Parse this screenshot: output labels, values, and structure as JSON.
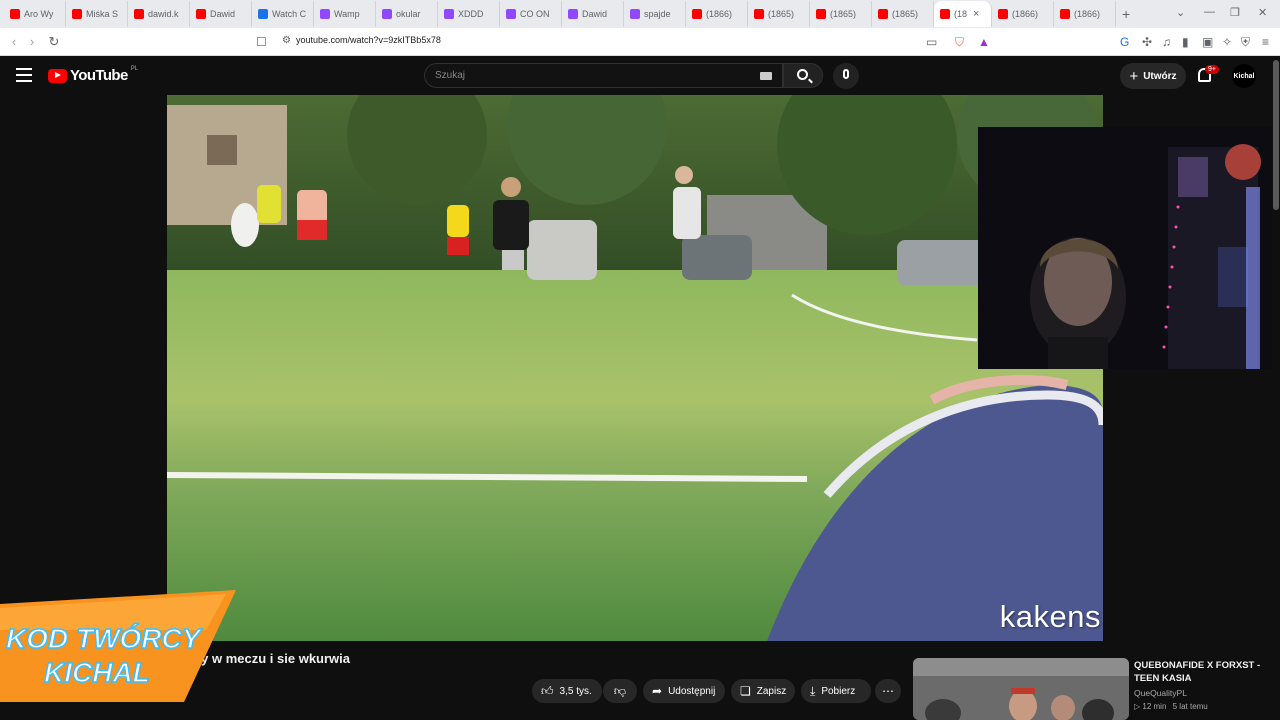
{
  "browser": {
    "tabs": [
      {
        "label": "Aro Wy",
        "color": "#ff0000"
      },
      {
        "label": "Miśka S",
        "color": "#ff0000"
      },
      {
        "label": "dawid.k",
        "color": "#ff0000"
      },
      {
        "label": "Dawid",
        "color": "#ff0000"
      },
      {
        "label": "Watch C",
        "color": "#1a73e8"
      },
      {
        "label": "Wamp",
        "color": "#9146ff"
      },
      {
        "label": "okular",
        "color": "#9146ff"
      },
      {
        "label": "XDDD",
        "color": "#9146ff"
      },
      {
        "label": "CO ON",
        "color": "#9146ff"
      },
      {
        "label": "Dawid",
        "color": "#9146ff"
      },
      {
        "label": "spajde",
        "color": "#9146ff"
      },
      {
        "label": "(1866)",
        "color": "#ff0000"
      },
      {
        "label": "(1865)",
        "color": "#ff0000"
      },
      {
        "label": "(1865)",
        "color": "#ff0000"
      },
      {
        "label": "(1865)",
        "color": "#ff0000"
      },
      {
        "label": "(18",
        "color": "#ff0000",
        "active": true
      },
      {
        "label": "(1866)",
        "color": "#ff0000"
      },
      {
        "label": "(1866)",
        "color": "#ff0000"
      }
    ],
    "new_tab": "+",
    "close_tab": "×",
    "url": "youtube.com/watch?v=9zkITBb5x78"
  },
  "youtube": {
    "logo_text": "YouTube",
    "country_code": "PL",
    "search_placeholder": "Szukaj",
    "create_label": "Utwórz",
    "notifications_badge": "9+",
    "avatar_text": "Kichal"
  },
  "video": {
    "watermark": "kakens",
    "title": "any w meczu i sie wkurwia"
  },
  "actions": {
    "likes": "3,5 tys.",
    "share": "Udostępnij",
    "save": "Zapisz",
    "download": "Pobierz",
    "more": "⋯"
  },
  "recommendation": {
    "title": "QUEBONAFIDE X FORXST - TEEN KASIA",
    "channel": "QueQualityPL",
    "duration": "12 min",
    "age": "5 lat temu"
  },
  "overlay": {
    "line1": "KOD TWÓRCY",
    "line2": "KICHAL",
    "accent": "#f7931e",
    "text_color": "#ffffff",
    "outline": "#37c0ff"
  }
}
